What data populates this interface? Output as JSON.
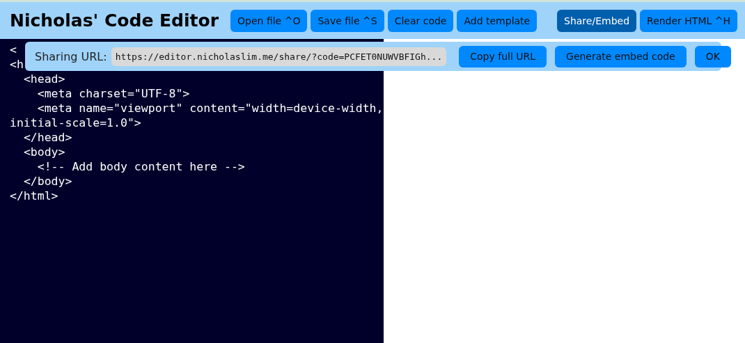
{
  "header": {
    "title": "Nicholas' Code Editor",
    "buttons": [
      {
        "label": "Open file ^O",
        "selected": false
      },
      {
        "label": "Save file ^S",
        "selected": false
      },
      {
        "label": "Clear code",
        "selected": false
      },
      {
        "label": "Add template",
        "selected": false
      }
    ],
    "right_buttons": [
      {
        "label": "Share/Embed",
        "selected": true
      },
      {
        "label": "Render HTML ^H",
        "selected": false
      }
    ]
  },
  "share_dialog": {
    "label": "Sharing URL:",
    "url": "https://editor.nicholaslim.me/share/?code=PCFET0NUWVBFIGh...",
    "buttons": [
      "Copy full URL",
      "Generate embed code",
      "OK"
    ]
  },
  "editor": {
    "lines": [
      "<",
      "<h",
      "  <head>",
      "    <meta charset=\"UTF-8\">",
      "    <meta name=\"viewport\" content=\"width=device-width, initial-scale=1.0\">",
      "  </head>",
      "  <body>",
      "    <!-- Add body content here -->",
      "  </body>",
      "</html>"
    ]
  }
}
